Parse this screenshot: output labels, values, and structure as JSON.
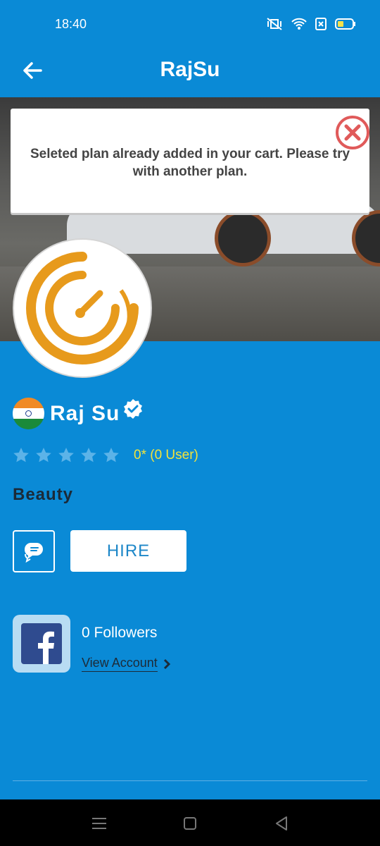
{
  "status": {
    "time": "18:40"
  },
  "app_bar": {
    "title": "RajSu"
  },
  "dialog": {
    "message": "Seleted plan already added in your cart. Please try with another plan."
  },
  "profile": {
    "name": "Raj Su",
    "rating_text": "0* (0 User)",
    "rating_value": 0,
    "category": "Beauty",
    "hire_label": "HIRE"
  },
  "social": {
    "followers": "0 Followers",
    "view_account": "View Account"
  },
  "colors": {
    "primary": "#0a8ad6",
    "rating_text": "#f2e33b",
    "close_icon": "#e05a5a",
    "logo_orange": "#e79a1c"
  }
}
